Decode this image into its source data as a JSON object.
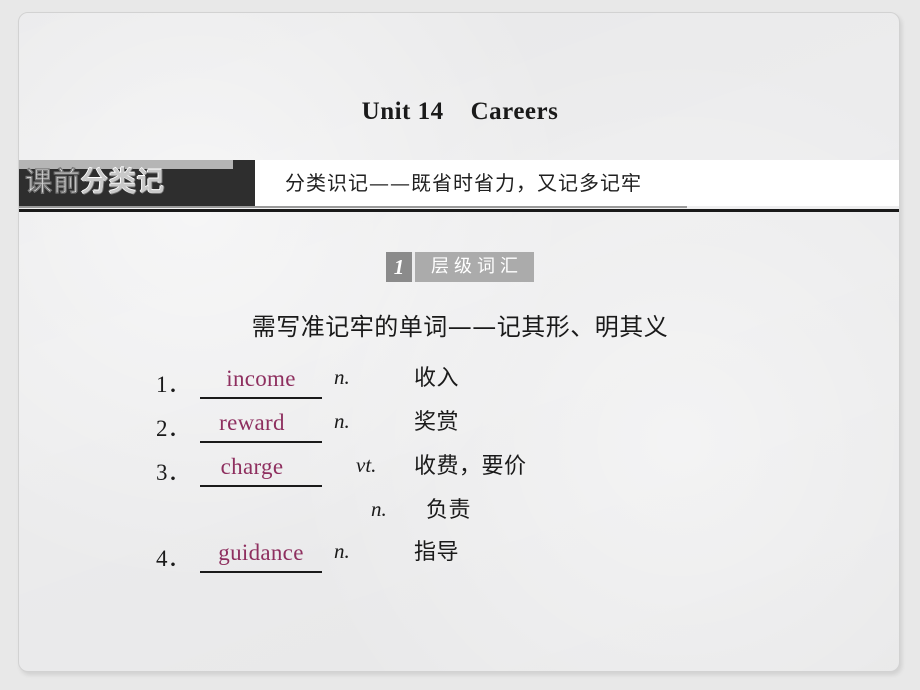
{
  "slide": {
    "unit_title": "Unit 14    Careers",
    "banner": {
      "tag_part_a": "课前",
      "tag_part_b": "分类记",
      "subtitle": "分类识记——既省时省力，又记多记牢"
    },
    "section": {
      "number": "1",
      "label": "层级词汇"
    },
    "sub_heading": "需写准记牢的单词——记其形、明其义",
    "vocab_items": [
      {
        "num": "1．",
        "word": "income",
        "pos": "n.",
        "meaning": "收入"
      },
      {
        "num": "2．",
        "word": "reward",
        "pos": "n.",
        "meaning": "奖赏"
      },
      {
        "num": "3．",
        "word": "charge",
        "pos": "vt.",
        "meaning": "收费，要价"
      },
      {
        "num": "",
        "word": "",
        "pos": "n.",
        "meaning": "负责"
      },
      {
        "num": "4．",
        "word": "guidance",
        "pos": "n.",
        "meaning": "指导"
      }
    ],
    "colors": {
      "word_accent": "#8e2f5f",
      "banner_dark": "#2e2e2e",
      "badge_num_bg": "#8b8b8b",
      "badge_label_bg": "#ababab",
      "page_bg": "#ececed"
    }
  }
}
